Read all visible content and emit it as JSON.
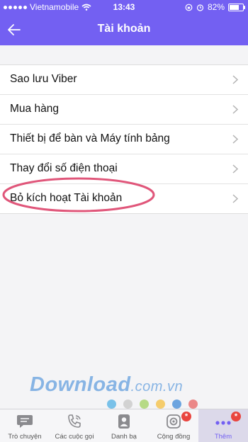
{
  "status_bar": {
    "carrier": "Vietnamobile",
    "time": "13:43",
    "battery": "82%",
    "battery_level": 0.82
  },
  "header": {
    "title": "Tài khoản",
    "back_icon": "arrow-left-icon"
  },
  "menu": {
    "items": [
      {
        "label": "Sao lưu Viber"
      },
      {
        "label": "Mua hàng"
      },
      {
        "label": "Thiết bị để bàn và Máy tính bảng"
      },
      {
        "label": "Thay đổi số điện thoại"
      },
      {
        "label": "Bỏ kích hoạt Tài khoản"
      }
    ]
  },
  "watermark": {
    "brand": "Download",
    "domain": ".com.vn",
    "dot_colors": [
      "#5ab4e6",
      "#c9c9c9",
      "#a6d36a",
      "#f5c24a",
      "#4a90d9",
      "#e86c6c"
    ]
  },
  "tabs": [
    {
      "label": "Trò chuyện",
      "icon": "chat-bubble-icon",
      "active": false
    },
    {
      "label": "Các cuộc gọi",
      "icon": "phone-icon",
      "active": false
    },
    {
      "label": "Danh bạ",
      "icon": "contact-icon",
      "active": false
    },
    {
      "label": "Cộng đồng",
      "icon": "community-icon",
      "active": false,
      "badge": "*"
    },
    {
      "label": "Thêm",
      "icon": "more-dots-icon",
      "active": true,
      "badge": "*"
    }
  ],
  "colors": {
    "accent": "#7360f2",
    "highlight": "#e0567a",
    "badge": "#e9453f"
  }
}
